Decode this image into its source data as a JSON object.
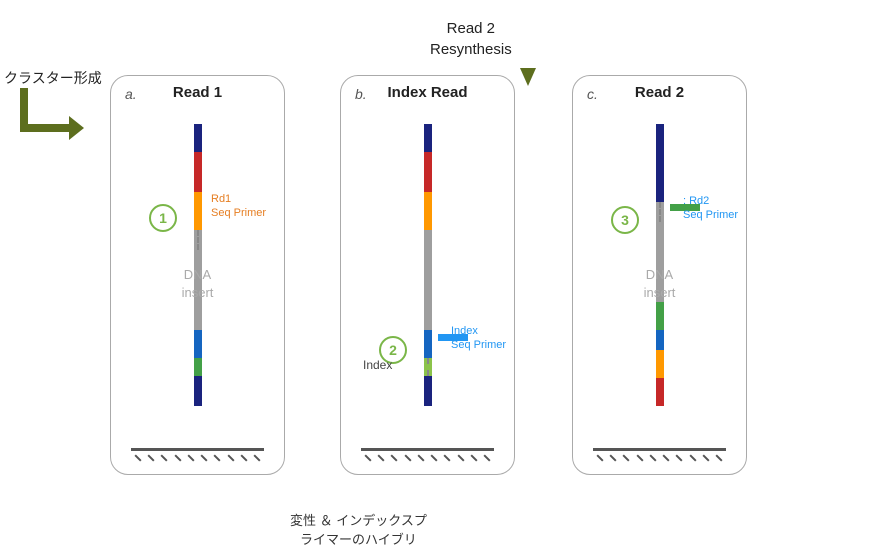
{
  "top_label": {
    "line1": "Read 2",
    "line2": "Resynthesis"
  },
  "cluster_label": "クラスター形成",
  "panels": [
    {
      "id": "a",
      "letter": "a.",
      "title": "Read 1",
      "step_num": "1",
      "primer_label": "Rd1\nSeq Primer",
      "dna_insert": "DNA\ninsert"
    },
    {
      "id": "b",
      "letter": "b.",
      "title": "Index Read",
      "step_num": "2",
      "primer_label": "Index\nSeq Primer",
      "index_label": "Index",
      "dna_insert": ""
    },
    {
      "id": "c",
      "letter": "c.",
      "title": "Read 2",
      "step_num": "3",
      "primer_label": ": Rd2\nSeq Primer",
      "dna_insert": "DNA\ninsert"
    }
  ],
  "bottom_note": "変性 ＆ インデックスプ\nライマーのハイブリ",
  "colors": {
    "dark_blue": "#1a237e",
    "blue": "#1565C0",
    "green": "#43a047",
    "light_green": "#8bc34a",
    "gray": "#9e9e9e",
    "orange": "#ff9800",
    "red": "#c62828",
    "olive": "#5d6e1e"
  }
}
